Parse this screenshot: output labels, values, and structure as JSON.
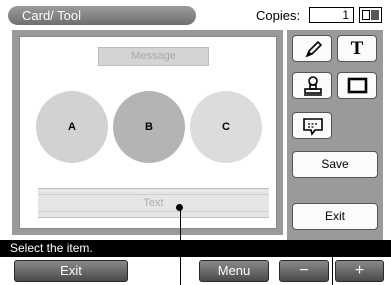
{
  "header": {
    "title": "Card/ Tool",
    "copies_label": "Copies:",
    "copies_value": "1"
  },
  "canvas": {
    "message_placeholder": "Message",
    "circles": [
      {
        "label": "A"
      },
      {
        "label": "B"
      },
      {
        "label": "C"
      }
    ],
    "text_placeholder": "Text"
  },
  "tools": {
    "pen_icon": "pen-icon",
    "text_icon_glyph": "T",
    "stamp_icon": "stamp-icon",
    "frame_icon": "frame-icon",
    "message_icon": "speech-bubble-icon",
    "save_label": "Save",
    "exit_label": "Exit"
  },
  "status": {
    "text": "Select the item."
  },
  "bottom_bar": {
    "exit_label": "Exit",
    "menu_label": "Menu",
    "minus_label": "−",
    "plus_label": "+"
  },
  "colors": {
    "panel_gray": "#9a9a9a",
    "status_black": "#000000",
    "button_gradient_top": "#8a8a8a",
    "button_gradient_bottom": "#4a4a4a"
  }
}
